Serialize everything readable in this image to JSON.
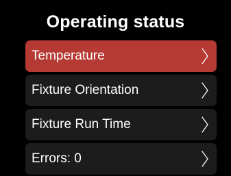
{
  "header": {
    "title": "Operating status"
  },
  "menu": {
    "items": [
      {
        "label": "Temperature",
        "selected": true
      },
      {
        "label": "Fixture Orientation",
        "selected": false
      },
      {
        "label": "Fixture Run Time",
        "selected": false
      },
      {
        "label": "Errors: 0",
        "selected": false
      }
    ]
  },
  "colors": {
    "background": "#000000",
    "item_background": "#1c1c1c",
    "selected_background": "#b53a33",
    "text": "#ffffff"
  },
  "icons": {
    "item_arrow": "chevron-right-icon"
  }
}
